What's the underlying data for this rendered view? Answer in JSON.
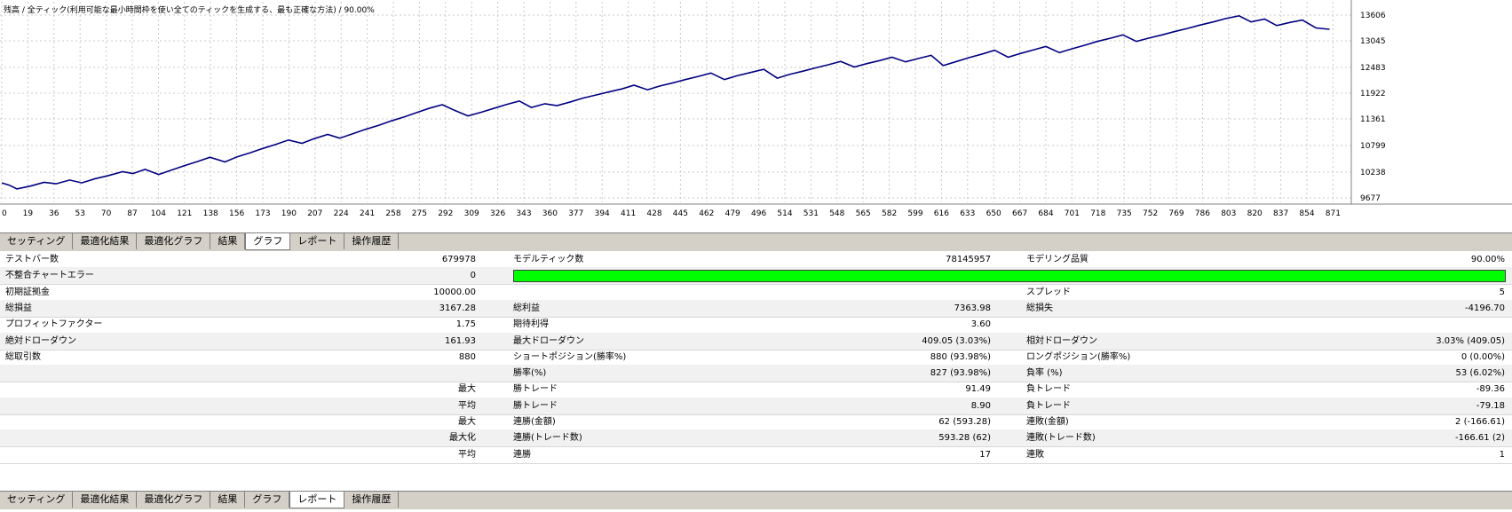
{
  "graph": {
    "title": "残高 / 全ティック(利用可能な最小時間枠を使い全てのティックを生成する、最も正確な方法) / 90.00%",
    "y_ticks": [
      "13606",
      "13045",
      "12483",
      "11922",
      "11361",
      "10799",
      "10238",
      "9677"
    ],
    "x_ticks": [
      "0",
      "19",
      "36",
      "53",
      "70",
      "87",
      "104",
      "121",
      "138",
      "156",
      "173",
      "190",
      "207",
      "224",
      "241",
      "258",
      "275",
      "292",
      "309",
      "326",
      "343",
      "360",
      "377",
      "394",
      "411",
      "428",
      "445",
      "462",
      "479",
      "496",
      "514",
      "531",
      "548",
      "565",
      "582",
      "599",
      "616",
      "633",
      "650",
      "667",
      "684",
      "701",
      "718",
      "735",
      "752",
      "769",
      "786",
      "803",
      "820",
      "837",
      "854",
      "871"
    ],
    "line_color": "#000080"
  },
  "chart_data": {
    "type": "line",
    "title": "残高 / 全ティック(利用可能な最小時間枠を使い全てのティックを生成する、最も正確な方法) / 90.00%",
    "xlabel": "",
    "ylabel": "",
    "xlim": [
      0,
      885
    ],
    "ylim": [
      9677,
      13800
    ],
    "grid": true,
    "series": [
      {
        "x": [
          0,
          5,
          10,
          19,
          28,
          36,
          45,
          53,
          62,
          70,
          80,
          87,
          95,
          104,
          113,
          121,
          130,
          138,
          148,
          156,
          165,
          173,
          182,
          190,
          199,
          207,
          216,
          224,
          233,
          241,
          250,
          258,
          267,
          275,
          283,
          292,
          300,
          309,
          318,
          326,
          334,
          343,
          351,
          360,
          368,
          377,
          385,
          394,
          403,
          411,
          419,
          428,
          436,
          445,
          453,
          462,
          470,
          479,
          487,
          496,
          505,
          514,
          522,
          531,
          539,
          548,
          556,
          565,
          573,
          582,
          590,
          599,
          607,
          616,
          624,
          633,
          641,
          650,
          658,
          667,
          675,
          684,
          692,
          701,
          709,
          718,
          726,
          735,
          743,
          752,
          760,
          769,
          777,
          786,
          794,
          803,
          811,
          820,
          828,
          837,
          845,
          854,
          862,
          871,
          880
        ],
        "y": [
          10000,
          9950,
          9870,
          9930,
          10010,
          9980,
          10060,
          10000,
          10090,
          10150,
          10240,
          10200,
          10290,
          10180,
          10280,
          10370,
          10460,
          10550,
          10450,
          10560,
          10650,
          10740,
          10830,
          10920,
          10850,
          10950,
          11040,
          10960,
          11060,
          11150,
          11240,
          11330,
          11420,
          11510,
          11600,
          11680,
          11560,
          11440,
          11520,
          11600,
          11680,
          11760,
          11620,
          11700,
          11660,
          11740,
          11820,
          11890,
          11960,
          12020,
          12100,
          12000,
          12080,
          12150,
          12220,
          12290,
          12360,
          12220,
          12300,
          12370,
          12440,
          12250,
          12330,
          12400,
          12470,
          12540,
          12610,
          12490,
          12560,
          12630,
          12700,
          12600,
          12670,
          12740,
          12520,
          12610,
          12690,
          12770,
          12850,
          12700,
          12780,
          12860,
          12930,
          12800,
          12880,
          12960,
          13040,
          13110,
          13180,
          13040,
          13110,
          13180,
          13250,
          13320,
          13390,
          13460,
          13530,
          13590,
          13460,
          13520,
          13380,
          13450,
          13500,
          13330,
          13300
        ]
      }
    ]
  },
  "tabs": {
    "items": [
      "セッティング",
      "最適化結果",
      "最適化グラフ",
      "結果",
      "グラフ",
      "レポート",
      "操作履歴"
    ],
    "top_active": "グラフ",
    "bottom_active": "レポート"
  },
  "report": {
    "rows": [
      {
        "l1": "テストバー数",
        "v1": "679978",
        "l2": "モデルティック数",
        "v2": "78145957",
        "l3": "モデリング品質",
        "v3": "90.00%"
      },
      {
        "l1": "不整合チャートエラー",
        "v1": "0",
        "quality": true
      },
      {
        "l1": "初期証拠金",
        "v1": "10000.00",
        "l2": "",
        "v2": "",
        "l3": "スプレッド",
        "v3": "5"
      },
      {
        "l1": "総損益",
        "v1": "3167.28",
        "l2": "総利益",
        "v2": "7363.98",
        "l3": "総損失",
        "v3": "-4196.70"
      },
      {
        "l1": "プロフィットファクター",
        "v1": "1.75",
        "l2": "期待利得",
        "v2": "3.60",
        "l3": "",
        "v3": ""
      },
      {
        "l1": "絶対ドローダウン",
        "v1": "161.93",
        "l2": "最大ドローダウン",
        "v2": "409.05 (3.03%)",
        "l3": "相対ドローダウン",
        "v3": "3.03% (409.05)"
      },
      {
        "l1": "総取引数",
        "v1": "880",
        "l2": "ショートポジション(勝率%)",
        "v2": "880 (93.98%)",
        "l3": "ロングポジション(勝率%)",
        "v3": "0 (0.00%)"
      },
      {
        "r1": "",
        "l2": "勝率(%)",
        "v2": "827 (93.98%)",
        "l3": "負率 (%)",
        "v3": "53 (6.02%)"
      },
      {
        "r1": "最大",
        "l2": "勝トレード",
        "v2": "91.49",
        "l3": "負トレード",
        "v3": "-89.36"
      },
      {
        "r1": "平均",
        "l2": "勝トレード",
        "v2": "8.90",
        "l3": "負トレード",
        "v3": "-79.18"
      },
      {
        "r1": "最大",
        "l2": "連勝(金額)",
        "v2": "62 (593.28)",
        "l3": "連敗(金額)",
        "v3": "2 (-166.61)"
      },
      {
        "r1": "最大化",
        "l2": "連勝(トレード数)",
        "v2": "593.28 (62)",
        "l3": "連敗(トレード数)",
        "v3": "-166.61 (2)"
      },
      {
        "r1": "平均",
        "l2": "連勝",
        "v2": "17",
        "l3": "連敗",
        "v3": "1"
      }
    ]
  }
}
